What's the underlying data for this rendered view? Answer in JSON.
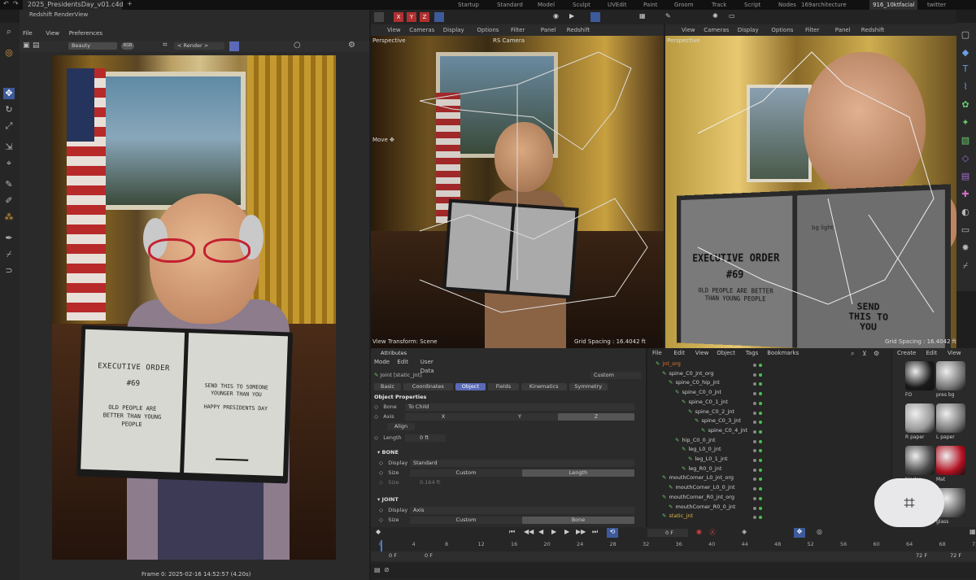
{
  "titlebar": {
    "file_tab": "2025_PresidentsDay_v01.c4d *"
  },
  "layouts": [
    "Startup",
    "Standard",
    "Model",
    "Sculpt",
    "UVEdit",
    "Paint",
    "Groom",
    "Track",
    "Script",
    "Nodes",
    "169architecture",
    "916_10ktfacial",
    "twitter"
  ],
  "active_layout": "916_10ktfacial",
  "renderview": {
    "title": "Redshift RenderView",
    "menu": [
      "File",
      "View",
      "Preferences"
    ],
    "aov": "Beauty",
    "render_target": "< Render >",
    "status": "Frame 0: 2025-02-16 14:52:57 (4.20s)"
  },
  "book": {
    "left_title": "EXECUTIVE ORDER",
    "left_number": "#69",
    "left_body": "OLD PEOPLE ARE BETTER THAN YOUNG PEOPLE",
    "right_line1": "SEND THIS TO SOMEONE YOUNGER THAN YOU",
    "right_line2": "HAPPY PRESIDENTS DAY"
  },
  "viewport1": {
    "menu": [
      "View",
      "Cameras",
      "Display",
      "Options",
      "Filter",
      "Panel",
      "Redshift"
    ],
    "label": "Perspective",
    "camera": "RS Camera",
    "tool": "Move",
    "transform": "View Transform: Scene",
    "grid": "Grid Spacing : 16.4042 ft"
  },
  "viewport2": {
    "menu": [
      "View",
      "Cameras",
      "Display",
      "Options",
      "Filter",
      "Panel",
      "Redshift"
    ],
    "label": "Perspective",
    "light": "bg light",
    "grid": "Grid Spacing : 16.4042 ft",
    "book_title": "EXECUTIVE ORDER",
    "book_number": "#69",
    "book_body": "OLD PEOPLE ARE BETTER THAN YOUNG PEOPLE",
    "book_right": "SEND THIS TO YOU"
  },
  "attributes": {
    "title": "Attributes",
    "menu": [
      "Mode",
      "Edit",
      "User Data"
    ],
    "object": "Joint [static_jnt]",
    "preset": "Custom",
    "tabs": [
      "Basic",
      "Coordinates",
      "Object",
      "Fields",
      "Kinematics",
      "Symmetry"
    ],
    "active_tab": "Object",
    "section": "Object Properties",
    "bone_label": "Bone",
    "bone_value": "To Child",
    "axis_label": "Axis",
    "axis_x": "X",
    "axis_y": "Y",
    "axis_z": "Z",
    "align": "Align",
    "length_label": "Length",
    "length_value": "0 ft",
    "bone_group": "BONE",
    "display_label": "Display",
    "display_value": "Standard",
    "size_label": "Size",
    "size_custom": "Custom",
    "size_length": "Length",
    "size2_label": "Size",
    "size2_value": "0.164 ft",
    "joint_group": "JOINT",
    "jdisplay_label": "Display",
    "jdisplay_value": "Axis",
    "jsize_label": "Size",
    "jsize_custom": "Custom",
    "jsize_bone": "Bone"
  },
  "objects": {
    "menu": [
      "File",
      "Edit",
      "View",
      "Object",
      "Tags",
      "Bookmarks"
    ],
    "items": [
      {
        "name": "jnt_org",
        "indent": 0,
        "color": "#e07a2a"
      },
      {
        "name": "spine_C0_jnt_org",
        "indent": 1,
        "color": "#cfcfcf"
      },
      {
        "name": "spine_C0_hip_jnt",
        "indent": 2,
        "color": "#cfcfcf"
      },
      {
        "name": "spine_C0_0_jnt",
        "indent": 3,
        "color": "#cfcfcf"
      },
      {
        "name": "spine_C0_1_jnt",
        "indent": 4,
        "color": "#cfcfcf"
      },
      {
        "name": "spine_C0_2_jnt",
        "indent": 5,
        "color": "#cfcfcf"
      },
      {
        "name": "spine_C0_3_jnt",
        "indent": 6,
        "color": "#cfcfcf"
      },
      {
        "name": "spine_C0_4_jnt",
        "indent": 7,
        "color": "#cfcfcf"
      },
      {
        "name": "hip_C0_0_jnt",
        "indent": 3,
        "color": "#cfcfcf"
      },
      {
        "name": "leg_L0_0_jnt",
        "indent": 4,
        "color": "#cfcfcf"
      },
      {
        "name": "leg_L0_1_jnt",
        "indent": 5,
        "color": "#cfcfcf"
      },
      {
        "name": "leg_R0_0_jnt",
        "indent": 4,
        "color": "#cfcfcf"
      },
      {
        "name": "mouthCorner_L0_jnt_org",
        "indent": 1,
        "color": "#cfcfcf"
      },
      {
        "name": "mouthCorner_L0_0_jnt",
        "indent": 2,
        "color": "#cfcfcf"
      },
      {
        "name": "mouthCorner_R0_jnt_org",
        "indent": 1,
        "color": "#cfcfcf"
      },
      {
        "name": "mouthCorner_R0_0_jnt",
        "indent": 2,
        "color": "#cfcfcf"
      },
      {
        "name": "static_jnt",
        "indent": 1,
        "color": "#e0b84a"
      }
    ]
  },
  "materials": {
    "menu": [
      "Create",
      "Edit",
      "View"
    ],
    "items": [
      "FO",
      "pres bg",
      "R paper",
      "L paper",
      "binder",
      "Mat",
      "",
      "glass"
    ]
  },
  "timeline": {
    "ticks": [
      "0",
      "4",
      "8",
      "12",
      "16",
      "20",
      "24",
      "28",
      "32",
      "36",
      "40",
      "44",
      "48",
      "52",
      "56",
      "60",
      "64",
      "68",
      "72"
    ],
    "current": "0 F",
    "frame_field": "0 F",
    "start": "0 F",
    "start2": "0 F",
    "end": "72 F",
    "end2": "72 F"
  }
}
